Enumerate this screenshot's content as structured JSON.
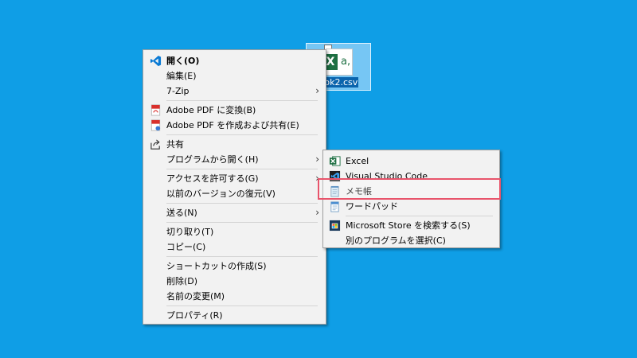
{
  "desktop": {
    "file_name": "ook2.csv"
  },
  "main_menu": {
    "items": [
      {
        "label": "開く(O)",
        "icon": "vscode-icon",
        "bold": true
      },
      {
        "label": "編集(E)"
      },
      {
        "label": "7-Zip",
        "submenu": true
      },
      {
        "label": "Adobe PDF に変換(B)",
        "icon": "adobe-pdf-icon"
      },
      {
        "label": "Adobe PDF を作成および共有(E)",
        "icon": "adobe-pdf-share-icon"
      },
      {
        "label": "共有",
        "icon": "share-icon"
      },
      {
        "label": "プログラムから開く(H)",
        "submenu": true
      },
      {
        "label": "アクセスを許可する(G)",
        "submenu": true
      },
      {
        "label": "以前のバージョンの復元(V)"
      },
      {
        "label": "送る(N)",
        "submenu": true
      },
      {
        "label": "切り取り(T)"
      },
      {
        "label": "コピー(C)"
      },
      {
        "label": "ショートカットの作成(S)"
      },
      {
        "label": "削除(D)"
      },
      {
        "label": "名前の変更(M)"
      },
      {
        "label": "プロパティ(R)"
      }
    ]
  },
  "open_with_menu": {
    "items": [
      {
        "label": "Excel",
        "icon": "excel-icon"
      },
      {
        "label": "Visual Studio Code",
        "icon": "vscode-icon"
      },
      {
        "label": "メモ帳",
        "icon": "notepad-icon"
      },
      {
        "label": "ワードパッド",
        "icon": "wordpad-icon"
      },
      {
        "label": "Microsoft Store を検索する(S)",
        "icon": "store-icon"
      },
      {
        "label": "別のプログラムを選択(C)"
      }
    ]
  },
  "colors": {
    "desktop_bg": "#0f9ee6",
    "menu_bg": "#f2f2f2",
    "highlight_border": "#e8546b",
    "excel_green": "#1d6f42",
    "vscode_blue": "#0a7ad4"
  }
}
